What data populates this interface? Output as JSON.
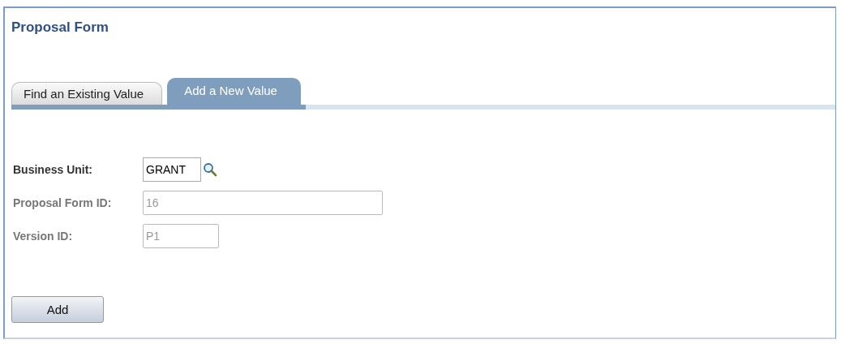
{
  "page": {
    "title": "Proposal Form"
  },
  "tabs": [
    {
      "label": "Find an Existing Value",
      "selected": false
    },
    {
      "label": "Add a New Value",
      "selected": true
    }
  ],
  "fields": [
    {
      "label": "Business Unit:",
      "value": "GRANT",
      "disabled": false,
      "kind": "lookup"
    },
    {
      "label": "Proposal Form ID:",
      "value": "16",
      "disabled": true,
      "kind": "text"
    },
    {
      "label": "Version ID:",
      "value": "P1",
      "disabled": true,
      "kind": "text"
    }
  ],
  "buttons": [
    {
      "label": "Add"
    }
  ]
}
